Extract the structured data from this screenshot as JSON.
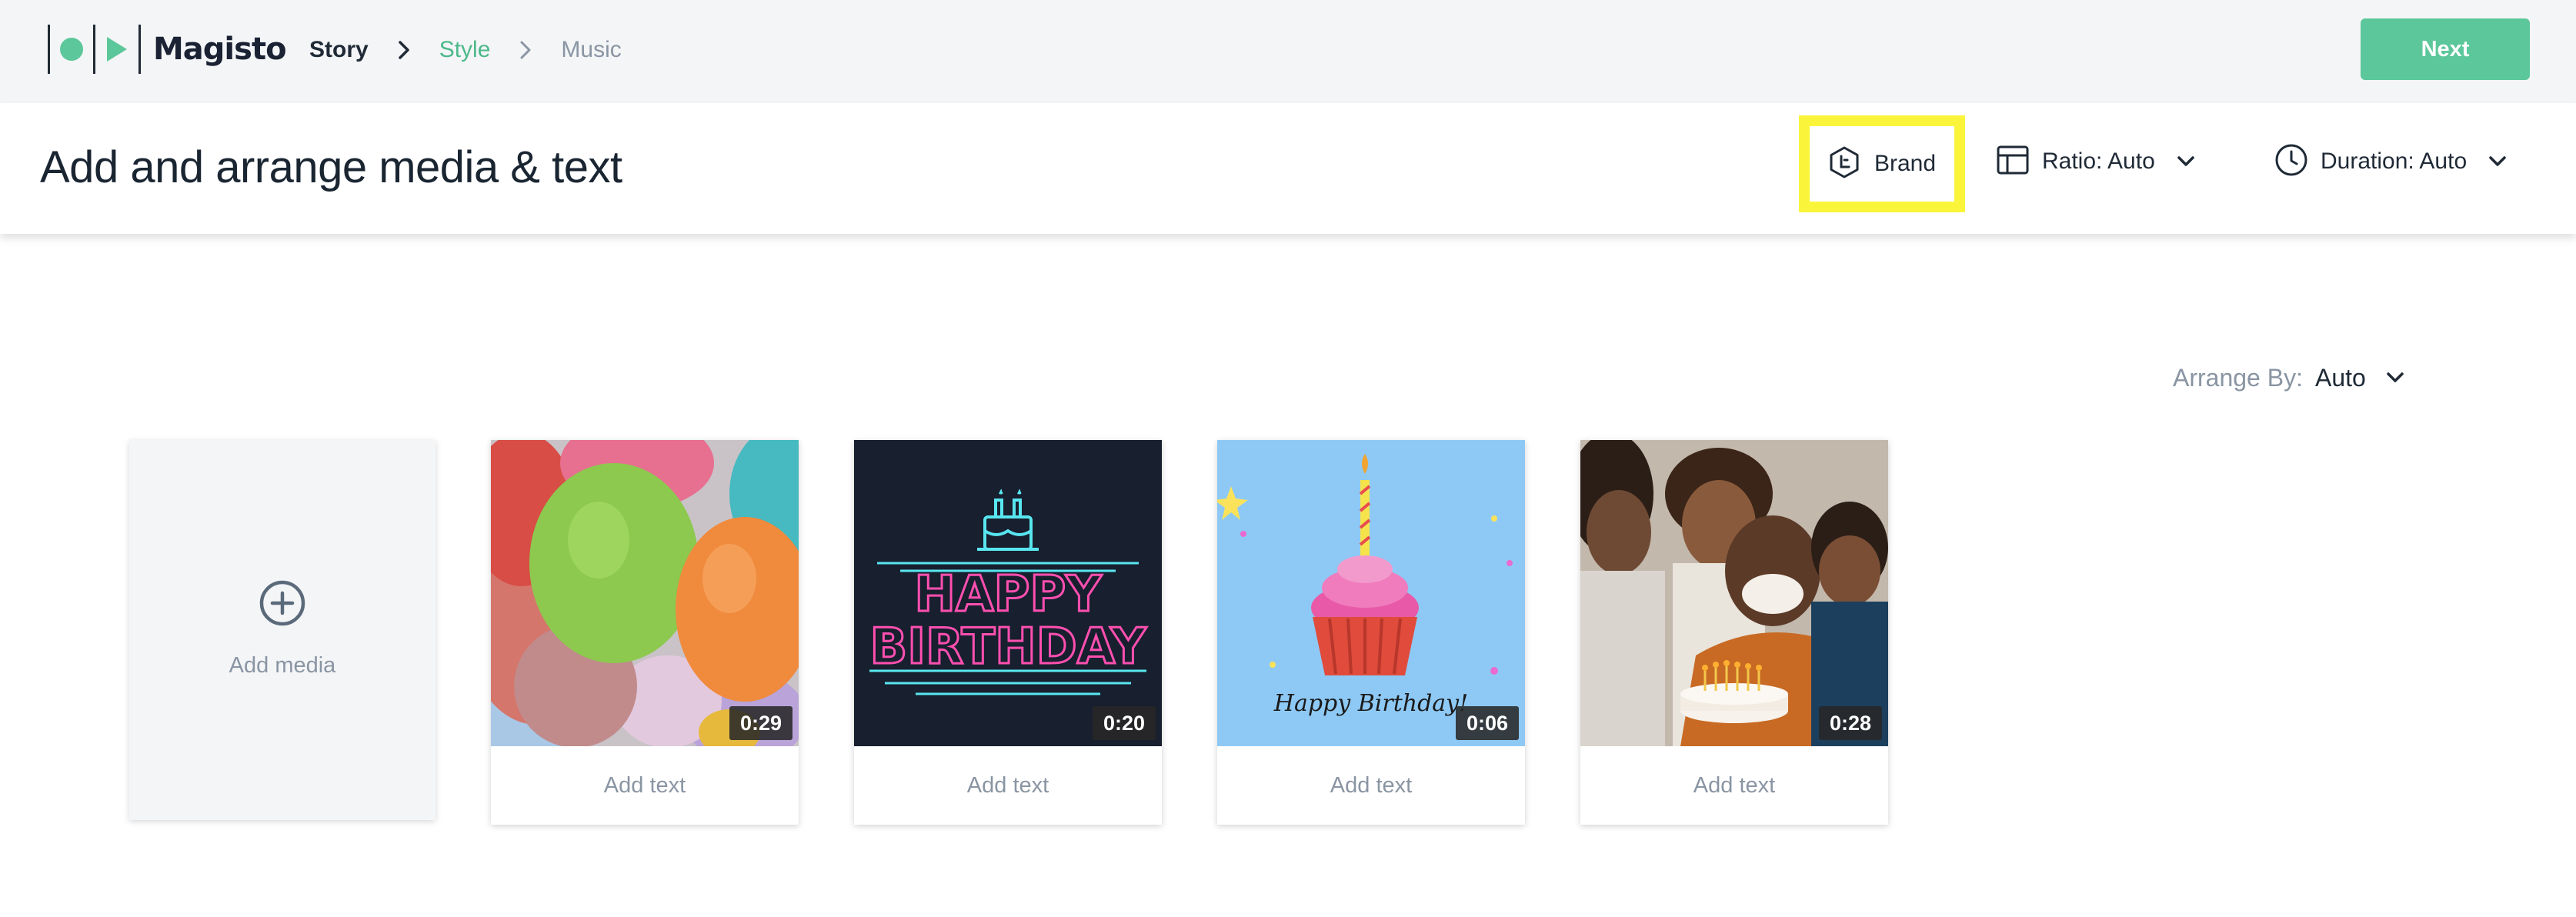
{
  "app": {
    "name": "Magisto"
  },
  "breadcrumbs": [
    {
      "label": "Story",
      "state": "completed"
    },
    {
      "label": "Style",
      "state": "current"
    },
    {
      "label": "Music",
      "state": "upcoming"
    }
  ],
  "nav": {
    "next_label": "Next"
  },
  "header": {
    "title": "Add and arrange media & text",
    "brand_label": "Brand",
    "ratio_label": "Ratio: Auto",
    "duration_label": "Duration: Auto"
  },
  "arrange": {
    "label": "Arrange By:",
    "value": "Auto"
  },
  "add_media": {
    "label": "Add media"
  },
  "media": [
    {
      "duration": "0:29",
      "add_text": "Add text",
      "thumbnail": "balloons"
    },
    {
      "duration": "0:20",
      "add_text": "Add text",
      "thumbnail": "neon-happy-birthday"
    },
    {
      "duration": "0:06",
      "add_text": "Add text",
      "thumbnail": "cupcake"
    },
    {
      "duration": "0:28",
      "add_text": "Add text",
      "thumbnail": "family-birthday-cake"
    }
  ],
  "thumb_text": {
    "neon_line1": "HAPPY",
    "neon_line2": "BIRTHDAY",
    "cupcake_caption": "Happy Birthday!"
  },
  "colors": {
    "accent": "#5cc79a",
    "highlight": "#faf53a",
    "text": "#1f2a36",
    "muted": "#8a95a3"
  }
}
